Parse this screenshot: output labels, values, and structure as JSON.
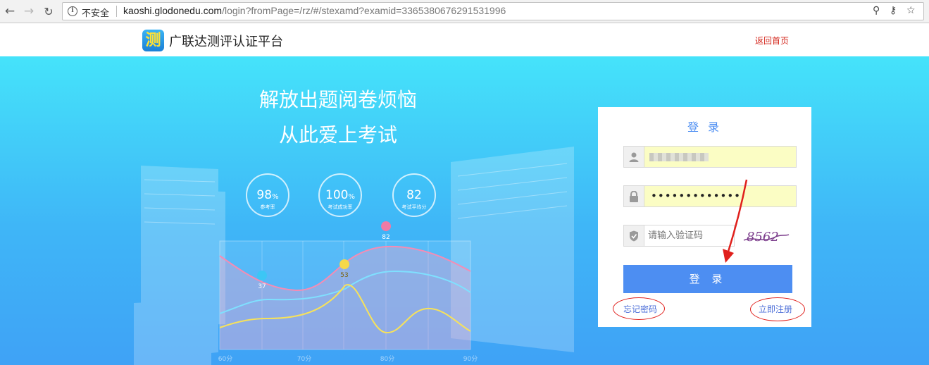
{
  "browser": {
    "security_label": "不安全",
    "url_host": "kaoshi.glodonedu.com",
    "url_rest": "/login?fromPage=/rz/#/stexamd?examid=3365380676291531996"
  },
  "header": {
    "site_name": "广联达测评认证平台",
    "logo_char": "测",
    "home_link": "返回首页"
  },
  "hero": {
    "slogan_line1": "解放出题阅卷烦恼",
    "slogan_line2": "从此爱上考试",
    "stats": [
      {
        "value": "98",
        "unit": "%",
        "label": "参考率"
      },
      {
        "value": "100",
        "unit": "%",
        "label": "考试成功率"
      },
      {
        "value": "82",
        "unit": "",
        "label": "考试平均分"
      }
    ],
    "chart_markers": [
      "37",
      "53",
      "82"
    ],
    "x_ticks": [
      "60分",
      "70分",
      "80分",
      "90分"
    ]
  },
  "login": {
    "title": "登 录",
    "username_value": "",
    "password_dots": "•••••••••••••",
    "captcha_placeholder": "请输入验证码",
    "captcha_code": "8562",
    "submit_label": "登 录",
    "forgot_label": "忘记密码",
    "register_label": "立即注册"
  },
  "colors": {
    "accent": "#4d8ef2",
    "home_link": "#d4281e",
    "annotation": "#e0201c"
  }
}
